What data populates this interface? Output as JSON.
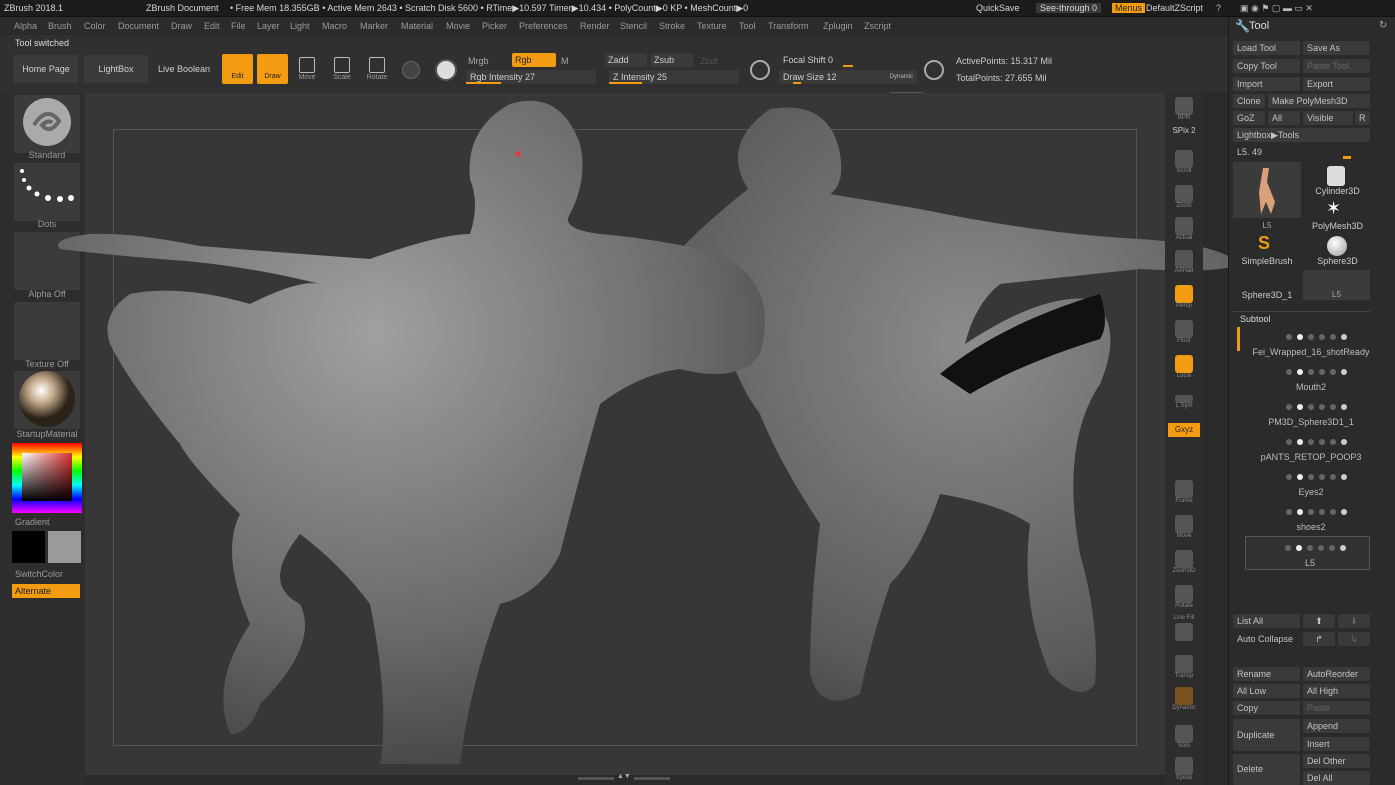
{
  "title_bar": {
    "app": "ZBrush 2018.1",
    "doc": "ZBrush Document",
    "stats": "• Free Mem 18.355GB • Active Mem 2643 • Scratch Disk 5600 • RTime▶10.597 Timer▶10.434 • PolyCount▶0 KP • MeshCount▶0",
    "quicksave": "QuickSave",
    "seethrough": "See-through 0",
    "menus": "Menus",
    "script": "DefaultZScript"
  },
  "menu": [
    "Alpha",
    "Brush",
    "Color",
    "Document",
    "Draw",
    "Edit",
    "File",
    "Layer",
    "Light",
    "Macro",
    "Marker",
    "Material",
    "Movie",
    "Picker",
    "Preferences",
    "Render",
    "Stencil",
    "Stroke",
    "Texture",
    "Tool",
    "Transform",
    "Zplugin",
    "Zscript"
  ],
  "status": "Tool switched",
  "toolbar": {
    "home": "Home Page",
    "lightbox": "LightBox",
    "live_boolean": "Live Boolean",
    "edit": "Edit",
    "draw": "Draw",
    "move": "Move",
    "scale": "Scale",
    "rotate": "Rotate",
    "mrgb": "Mrgb",
    "rgb": "Rgb",
    "m": "M",
    "zadd": "Zadd",
    "zsub": "Zsub",
    "zcut": "Zcut",
    "rgb_intensity": "Rgb Intensity 27",
    "z_intensity": "Z Intensity 25",
    "focal_shift": "Focal Shift 0",
    "draw_size": "Draw Size 12",
    "dynamic": "Dynamic",
    "active_points": "ActivePoints: 15.317 Mil",
    "total_points": "TotalPoints: 27.655 Mil"
  },
  "left": {
    "brush": "Standard",
    "stroke": "Dots",
    "alpha": "Alpha Off",
    "texture": "Texture Off",
    "material": "StartupMaterial",
    "gradient": "Gradient",
    "switchcolor": "SwitchColor",
    "alternate": "Alternate"
  },
  "right_shelf": [
    "BPR",
    "SPix 2",
    "Scroll",
    "Zoom",
    "Actual",
    "AAHalf",
    "Persp",
    "Floor",
    "Local",
    "L.Sym",
    "Gxyz",
    "Frame",
    "Move",
    "Zoom3D",
    "Rotate",
    "Line Fill",
    "Transp",
    "Dynamic",
    "Solo",
    "Xpose"
  ],
  "tool_panel": {
    "title": "Tool",
    "load": "Load Tool",
    "save": "Save As",
    "copy": "Copy Tool",
    "paste": "Paste Tool",
    "import": "Import",
    "export": "Export",
    "clone": "Clone",
    "make": "Make PolyMesh3D",
    "goz": "GoZ",
    "all": "All",
    "visible": "Visible",
    "r": "R",
    "lightbox": "Lightbox▶Tools",
    "l5": "L5. 49",
    "tools": [
      "L5",
      "Cylinder3D",
      "PolyMesh3D",
      "SimpleBrush",
      "Sphere3D",
      "Sphere3D_1",
      "L5"
    ],
    "subtool": "Subtool",
    "subtools": [
      "Fei_Wrapped_16_shotReady",
      "Mouth2",
      "PM3D_Sphere3D1_1",
      "pANTS_RETOP_POOP3",
      "Eyes2",
      "shoes2",
      "L5"
    ],
    "list_all": "List All",
    "auto_collapse": "Auto Collapse",
    "rename": "Rename",
    "autoreorder": "AutoReorder",
    "all_low": "All Low",
    "all_high": "All High",
    "copy2": "Copy",
    "paste2": "Paste",
    "duplicate": "Duplicate",
    "append": "Append",
    "insert": "Insert",
    "delete": "Delete",
    "del_other": "Del Other",
    "del_all": "Del All"
  },
  "colors": {
    "accent": "#f39c12"
  }
}
